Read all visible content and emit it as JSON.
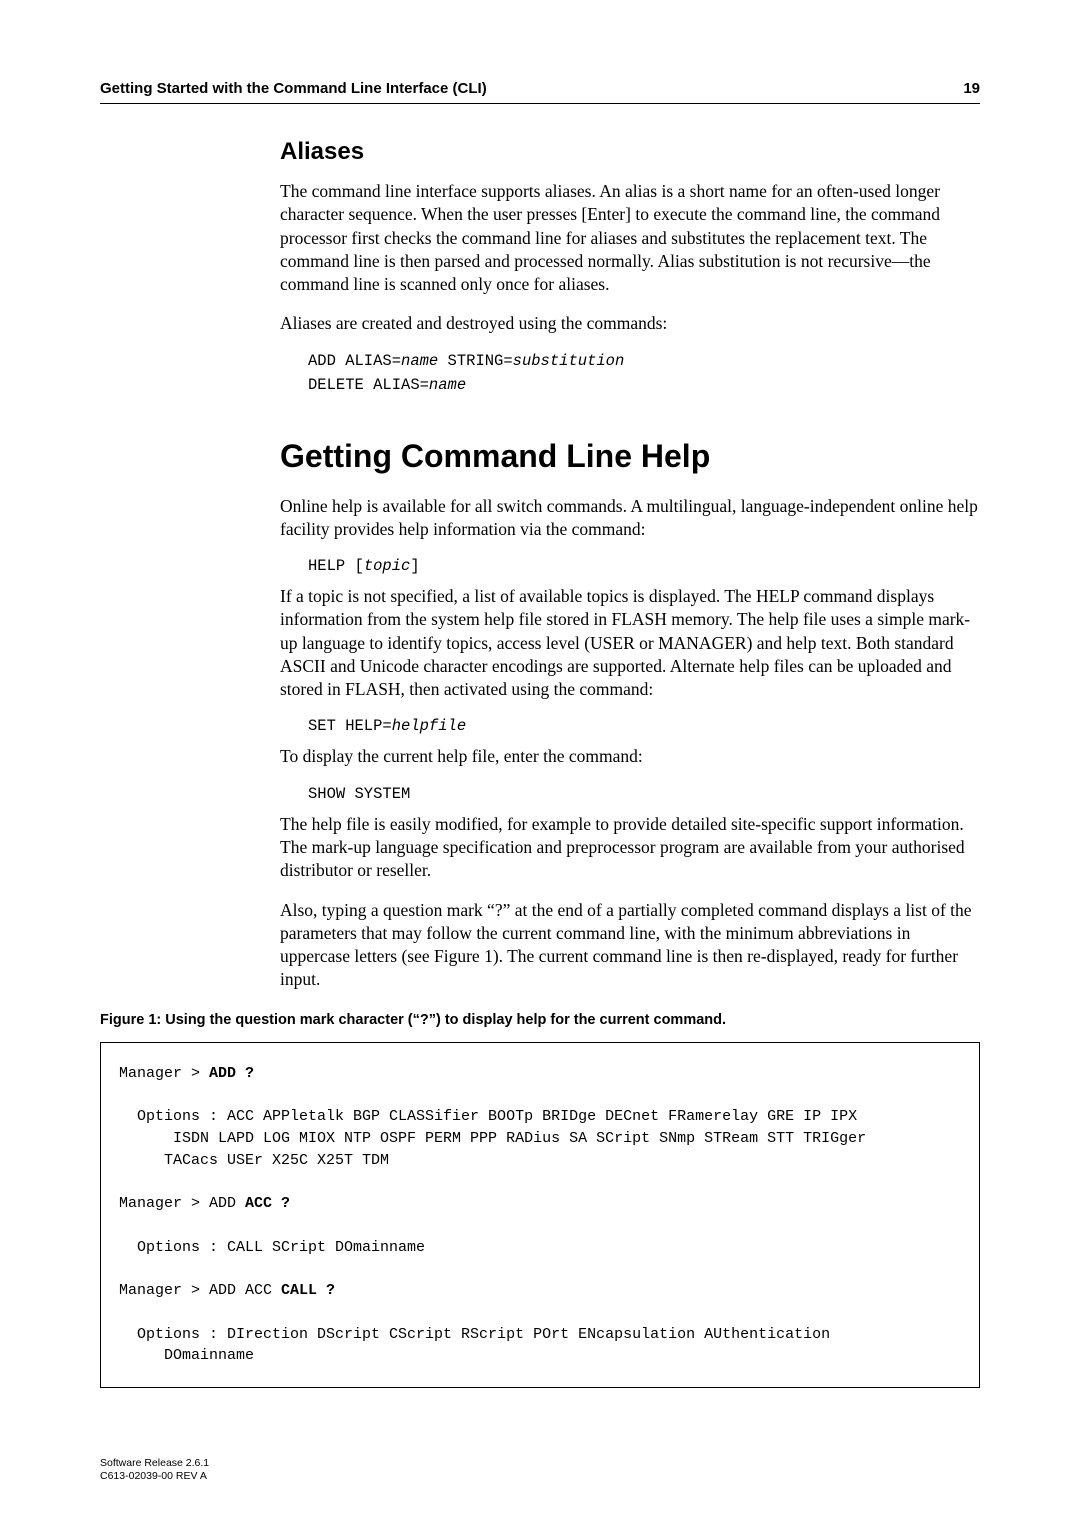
{
  "header": {
    "title": "Getting Started with the Command Line Interface (CLI)",
    "page_number": "19"
  },
  "section_aliases": {
    "heading": "Aliases",
    "p1": "The command line interface supports aliases. An alias is a short name for an often-used longer character sequence. When the user presses [Enter] to execute the command line, the command processor first checks the command line for aliases and substitutes the replacement text. The command line is then parsed and processed normally. Alias substitution is not recursive—the command line is scanned only once for aliases.",
    "p2": "Aliases are created and destroyed using the commands:",
    "cmd1_prefix": "ADD ALIAS=",
    "cmd1_ital1": "name",
    "cmd1_mid": " STRING=",
    "cmd1_ital2": "substitution",
    "cmd2_prefix": "DELETE ALIAS=",
    "cmd2_ital1": "name"
  },
  "section_help": {
    "heading": "Getting Command Line Help",
    "p1": "Online help is available for all switch commands. A multilingual, language-independent online help facility provides help information via the command:",
    "cmd_help_prefix": "HELP [",
    "cmd_help_ital": "topic",
    "cmd_help_suffix": "]",
    "p2": "If a topic is not specified, a list of available topics is displayed. The HELP command displays information from the system help file stored in FLASH memory. The help file uses a simple mark-up language to identify topics, access level (USER or MANAGER) and help text. Both standard ASCII and Unicode character encodings are supported. Alternate help files can be uploaded and stored in FLASH, then activated using the command:",
    "cmd_set_prefix": "SET HELP=",
    "cmd_set_ital": "helpfile",
    "p3": "To display the current help file, enter the command:",
    "cmd_show": "SHOW SYSTEM",
    "p4": "The help file is easily modified, for example to provide detailed site-specific support information. The mark-up language specification and preprocessor program are available from your authorised distributor or reseller.",
    "p5": "Also, typing a question mark “?” at the end of a partially completed command displays a list of the parameters that may follow the current command line, with the minimum abbreviations in uppercase letters (see Figure 1). The current command line is then re-displayed, ready for further input."
  },
  "figure": {
    "caption": "Figure 1: Using the question mark character (“?”) to display help for the current command.",
    "line1_prefix": "Manager > ",
    "line1_bold": "ADD ?",
    "opts1": "  Options : ACC APPletalk BGP CLASSifier BOOTp BRIDge DECnet FRamerelay GRE IP IPX\n      ISDN LAPD LOG MIOX NTP OSPF PERM PPP RADius SA SCript SNmp STReam STT TRIGger\n     TACacs USEr X25C X25T TDM",
    "line2_prefix": "Manager > ADD ",
    "line2_bold": "ACC ?",
    "opts2": "  Options : CALL SCript DOmainname",
    "line3_prefix": "Manager > ADD ACC ",
    "line3_bold": "CALL ?",
    "opts3": "  Options : DIrection DScript CScript RScript POrt ENcapsulation AUthentication\n     DOmainname"
  },
  "footer": {
    "line1": "Software Release 2.6.1",
    "line2": "C613-02039-00 REV A"
  }
}
